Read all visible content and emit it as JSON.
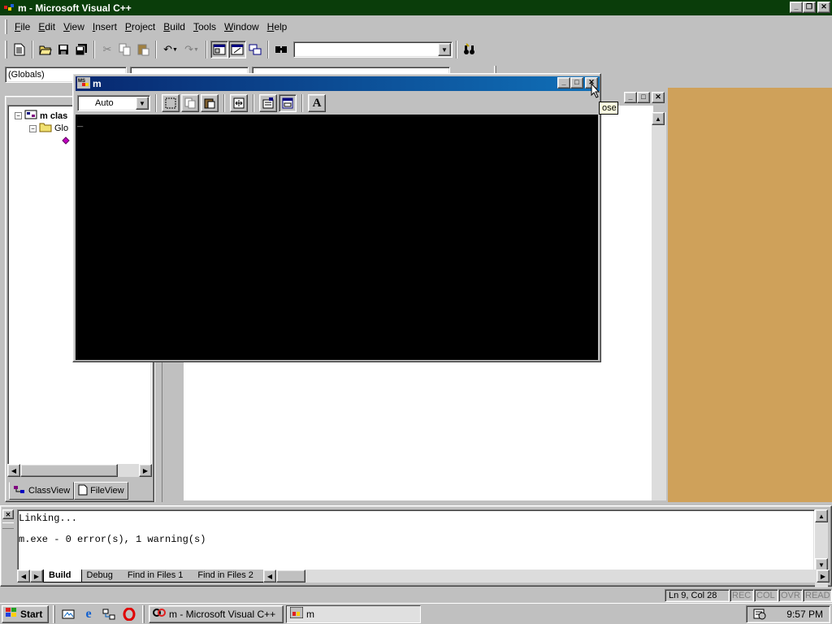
{
  "app": {
    "title": "m - Microsoft Visual C++"
  },
  "menu": [
    "File",
    "Edit",
    "View",
    "Insert",
    "Project",
    "Build",
    "Tools",
    "Window",
    "Help"
  ],
  "menu_mnemonic": [
    "F",
    "E",
    "V",
    "I",
    "P",
    "B",
    "T",
    "W",
    "H"
  ],
  "toolbar2": {
    "globals_combo": "(Globals)"
  },
  "workspace": {
    "root_label": "m clas",
    "folder_label": "Glo",
    "tabs": [
      "ClassView",
      "FileView"
    ]
  },
  "console": {
    "title": "m",
    "font_size": "Auto",
    "cursor": "_"
  },
  "tooltip": {
    "text": "ose"
  },
  "output": {
    "lines": [
      "Linking...",
      "",
      "m.exe - 0 error(s), 1 warning(s)"
    ],
    "tabs": [
      "Build",
      "Debug",
      "Find in Files 1",
      "Find in Files 2"
    ]
  },
  "status": {
    "position": "Ln 9, Col 28",
    "indicators": [
      "REC",
      "COL",
      "OVR",
      "READ"
    ]
  },
  "taskbar": {
    "start": "Start",
    "buttons": [
      "m - Microsoft Visual C++",
      "m"
    ],
    "clock": "9:57 PM"
  },
  "colors": {
    "titlebar": "#0a3d0a",
    "console_title": "#082870",
    "mdi_background": "#cfa15a"
  }
}
